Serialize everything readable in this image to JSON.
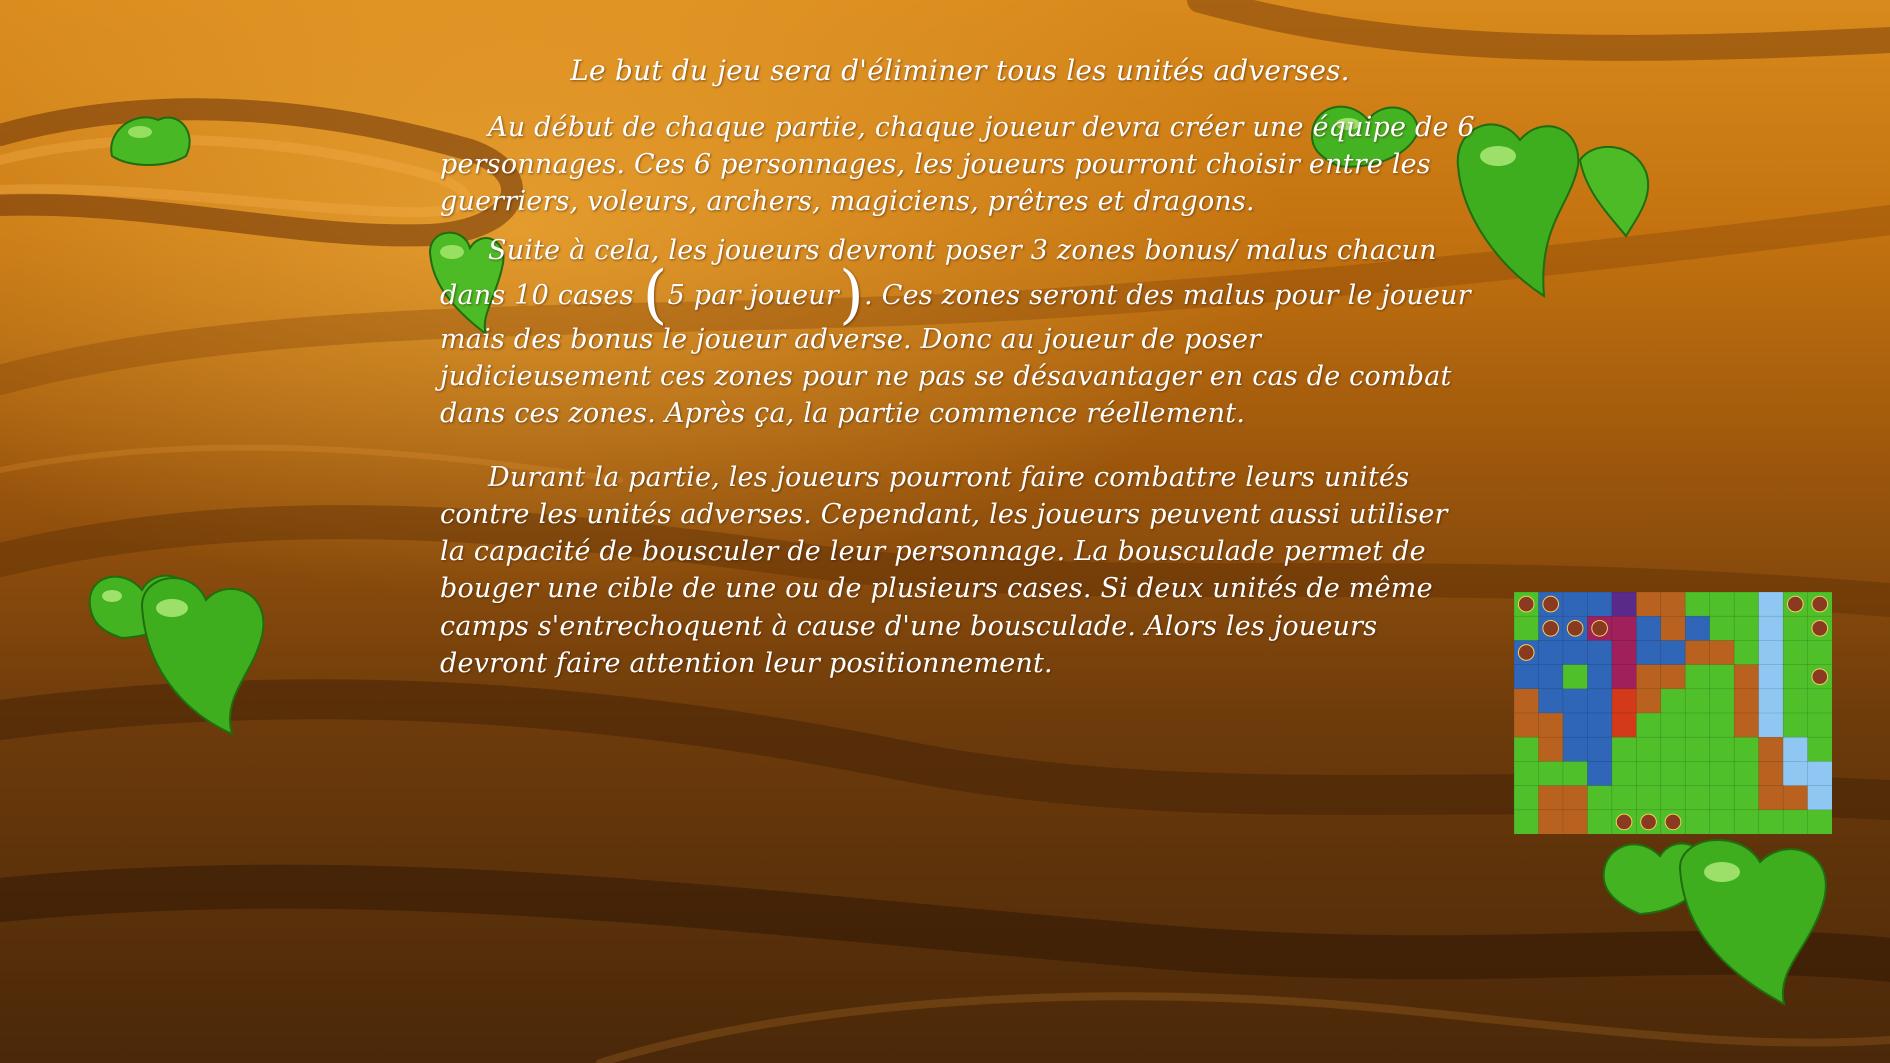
{
  "slide": {
    "title_line": "Le but du jeu sera d'éliminer tous les unités adverses.",
    "paragraph1": {
      "p1": "Au début de chaque partie, chaque joueur devra créer une équipe de 6 personnages. Ces 6 personnages, les joueurs pourront choisir entre les guerriers, voleurs, archers, magiciens, prêtres et dragons.",
      "p2_start": "Suite à cela, les joueurs devront poser 3 zones bonus/ malus chacun dans 10 cases",
      "paren_open": "(",
      "paren_text": "5 par joueur",
      "paren_close": ")",
      "p2_end": ". Ces zones seront des malus pour le joueur mais des bonus le joueur adverse. Donc au joueur de poser judicieusement ces zones pour ne pas se désavantager en cas de combat dans ces zones. Après ça, la partie commence réellement."
    },
    "paragraph2": "Durant la partie, les joueurs pourront faire combattre leurs unités contre les unités adverses. Cependant, les joueurs peuvent aussi utiliser la capacité de bousculer de leur personnage. La bousculade permet de bouger une cible de une ou de plusieurs cases. Si deux unités de même camps s'entrechoquent à cause d'une bousculade. Alors les joueurs devront faire attention leur positionnement."
  },
  "colors": {
    "text": "#ffffff",
    "leaf_green": "#3fae1e",
    "tile_grass": "#4fbf2a",
    "tile_blue": "#2f66b8",
    "tile_dirt": "#b9621f",
    "tile_magenta": "#a0205c",
    "tile_purple": "#5a2a8a",
    "tile_red": "#d23a1a",
    "tile_water": "#8ec7f2"
  }
}
